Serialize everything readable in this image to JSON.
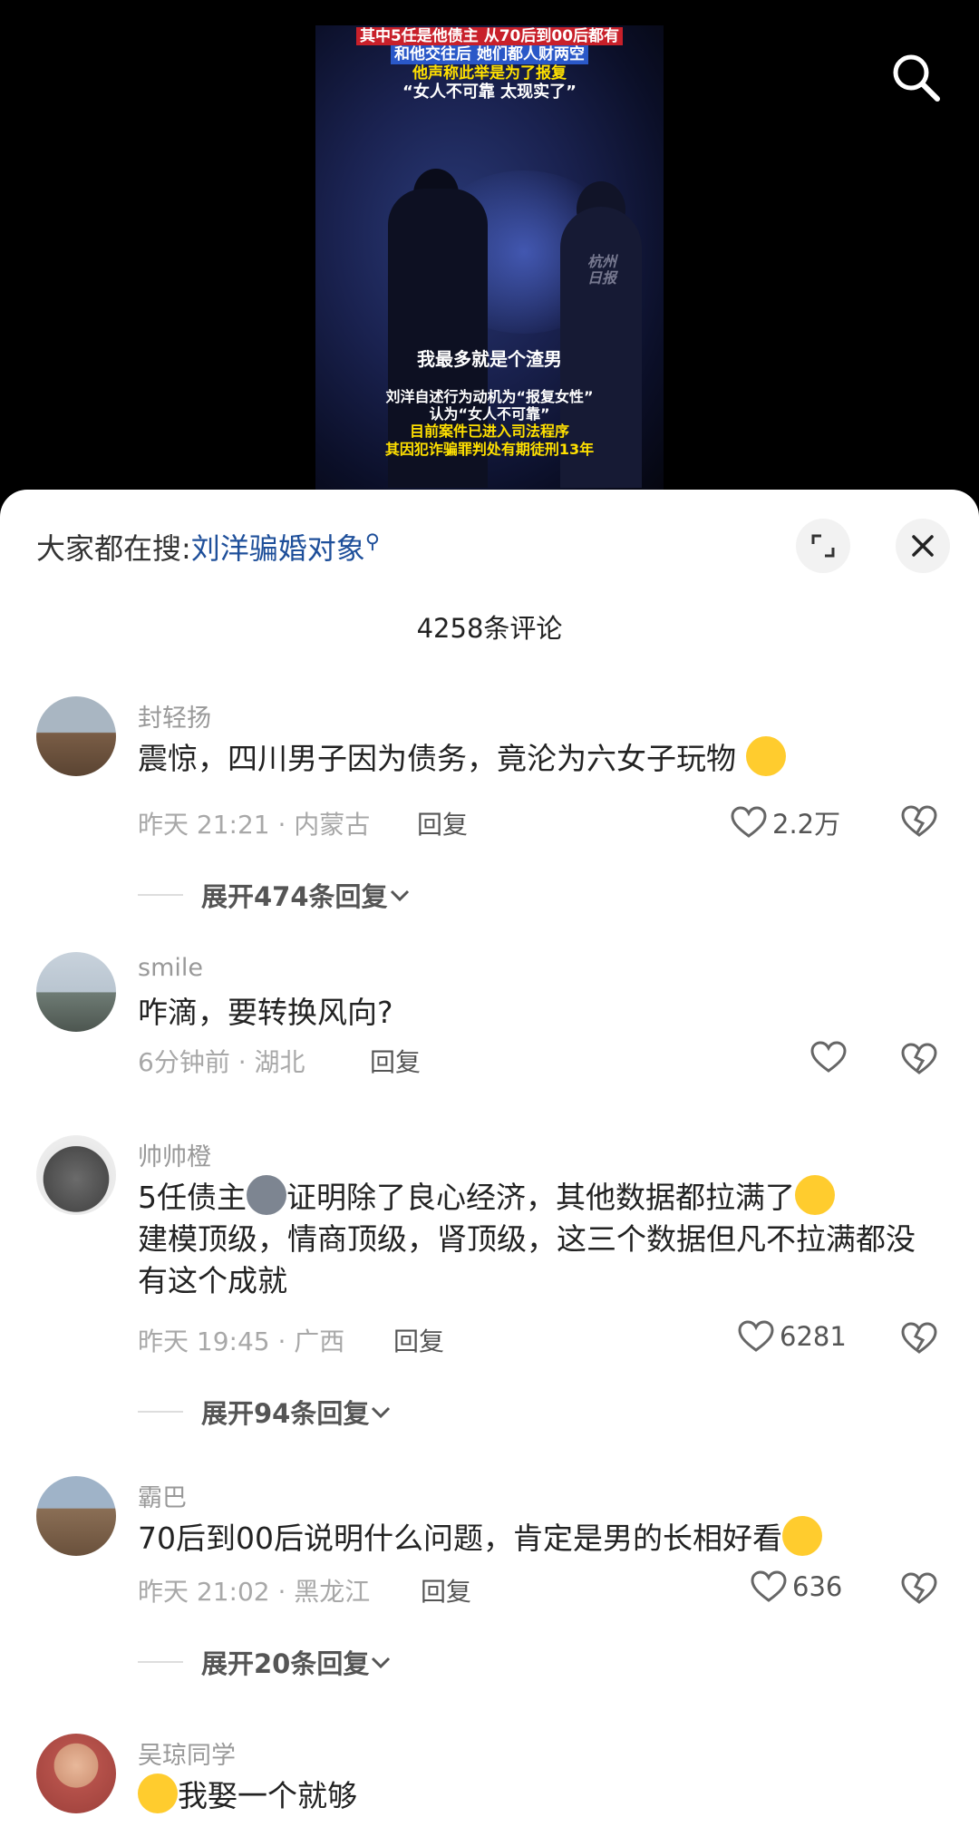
{
  "video": {
    "caption_top": [
      "其中5任是他债主 从70后到00后都有",
      "和他交往后 她们都人财两空",
      "他声称此举是为了报复",
      "“女人不可靠 太现实了”"
    ],
    "watermark": [
      "杭州",
      "日报"
    ],
    "caption_mid": "我最多就是个渣男",
    "caption_bottom": [
      "刘洋自述行为动机为“报复女性”",
      "认为“女人不可靠”",
      "目前案件已进入司法程序",
      "其因犯诈骗罪判处有期徒刑13年"
    ]
  },
  "search_bar": {
    "prefix": "大家都在搜:",
    "keyword": "刘洋骗婚对象"
  },
  "comment_count": "4258条评论",
  "comments": [
    {
      "user": "封轻扬",
      "text": "震惊，四川男子因为债务，竟沦为六女子玩物",
      "time_loc": "昨天 21:21 · 内蒙古",
      "reply": "回复",
      "likes": "2.2万",
      "expand": "展开474条回复"
    },
    {
      "user": "smile",
      "text": "咋滴，要转换风向?",
      "time_loc": "6分钟前 · 湖北",
      "reply": "回复",
      "likes": ""
    },
    {
      "user": "帅帅橙",
      "text_a": "5任债主",
      "text_b": "证明除了良心经济，其他数据都拉满了",
      "text_c": "建模顶级，情商顶级，肾顶级，这三个数据但凡不拉满都没有这个成就",
      "time_loc": "昨天 19:45 · 广西",
      "reply": "回复",
      "likes": "6281",
      "expand": "展开94条回复"
    },
    {
      "user": "霸巴",
      "text": "70后到00后说明什么问题，肯定是男的长相好看",
      "time_loc": "昨天 21:02 · 黑龙江",
      "reply": "回复",
      "likes": "636",
      "expand": "展开20条回复"
    },
    {
      "user": "吴琼同学",
      "text": "我娶一个就够"
    }
  ],
  "colors": {
    "accent": "#1e4f9a",
    "caption_yellow": "#ffe000"
  }
}
